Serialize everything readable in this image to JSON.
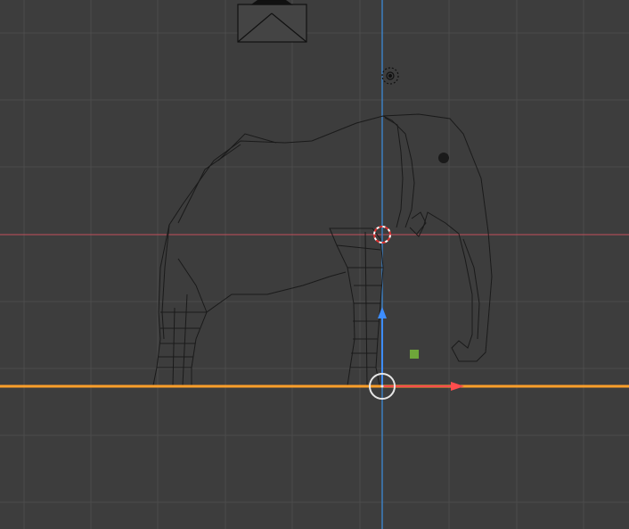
{
  "viewport": {
    "background": "#3d3d3d",
    "grid_color": "#4c4c4c",
    "x_axis_color": "#c2505c",
    "z_axis_color": "#3d7ec2",
    "selected_object_color": "#ff9f2a"
  },
  "objects": {
    "camera": {
      "icon": "camera-icon"
    },
    "light": {
      "icon": "light-icon"
    },
    "model": {
      "icon": "elephant-mesh-icon"
    },
    "ground_plane": {
      "icon": "ground-plane-edge",
      "selected": true
    }
  },
  "gizmo": {
    "origin_icon": "3d-cursor-icon",
    "pivot_icon": "transform-pivot-icon",
    "up_arrow_color": "#3d8dff",
    "right_arrow_color": "#ff4d4d",
    "plane_handle_color": "#6ea63a"
  }
}
